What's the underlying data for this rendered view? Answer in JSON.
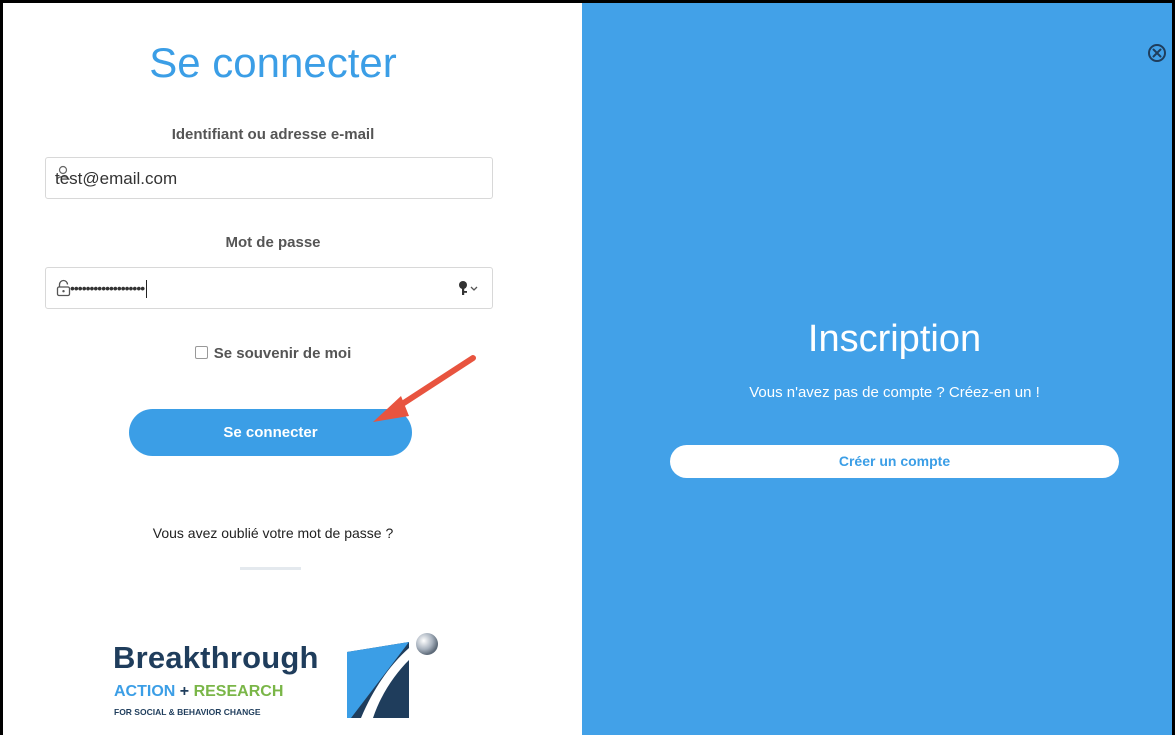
{
  "login": {
    "title": "Se connecter",
    "username_label": "Identifiant ou adresse e-mail",
    "username_value": "test@email.com",
    "password_label": "Mot de passe",
    "password_dots": "•••••••••••••••••••",
    "remember_label": "Se souvenir de moi",
    "submit_label": "Se connecter",
    "forgot_link": "Vous avez oublié votre mot de passe ?"
  },
  "logo": {
    "line1": "Breakthrough",
    "line2_a": "ACTION",
    "line2_plus": "+",
    "line2_b": "RESEARCH",
    "line3": "FOR SOCIAL & BEHAVIOR CHANGE"
  },
  "register": {
    "title": "Inscription",
    "subtitle": "Vous n'avez pas de compte ? Créez-en un !",
    "button_label": "Créer un compte"
  },
  "colors": {
    "accent": "#3b9ee6",
    "panel": "#42a1e8",
    "annotation_arrow": "#e8543f"
  },
  "icons": [
    "user-icon",
    "lock-icon",
    "key-icon",
    "close-icon",
    "arrow-annotation"
  ]
}
